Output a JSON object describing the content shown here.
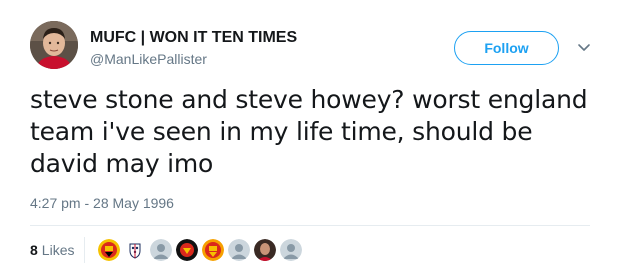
{
  "author": {
    "display_name": "MUFC | WON IT TEN TIMES",
    "handle": "@ManLikePallister"
  },
  "actions": {
    "follow_label": "Follow"
  },
  "tweet": {
    "line1": "steve stone and steve howey? worst england",
    "line2": "team i've seen in my life time, should be",
    "line3": "david may imo",
    "timestamp": "4:27 pm - 28 May 1996"
  },
  "stats": {
    "likes_count": "8",
    "likes_label": "Likes"
  },
  "likers": [
    {
      "icon": "mufc-crest-icon"
    },
    {
      "icon": "england-crest-icon"
    },
    {
      "icon": "default-avatar-icon"
    },
    {
      "icon": "mufc-crest-icon"
    },
    {
      "icon": "mufc-crest-icon"
    },
    {
      "icon": "default-avatar-icon"
    },
    {
      "icon": "player-photo-icon"
    },
    {
      "icon": "default-avatar-icon"
    }
  ],
  "colors": {
    "accent": "#1da1f2",
    "text": "#14171a",
    "secondary": "#657786",
    "divider": "#e6ecf0"
  }
}
